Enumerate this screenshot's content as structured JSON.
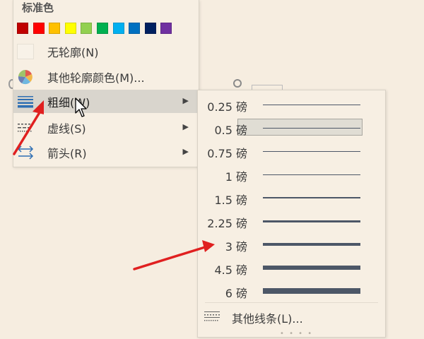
{
  "menu": {
    "standard_colors_title": "标准色",
    "swatches": [
      "#c00000",
      "#ff0000",
      "#ffc000",
      "#ffff00",
      "#92d050",
      "#00b050",
      "#00b0f0",
      "#0070c0",
      "#002060",
      "#7030a0"
    ],
    "items": [
      {
        "label": "无轮廓(N)",
        "icon": "no-outline-box",
        "has_submenu": false
      },
      {
        "label": "其他轮廓颜色(M)...",
        "icon": "color-palette-icon",
        "has_submenu": false
      },
      {
        "label": "粗细(W)",
        "icon": "line-weight-icon",
        "has_submenu": true,
        "highlighted": true
      },
      {
        "label": "虚线(S)",
        "icon": "dash-line-icon",
        "has_submenu": true
      },
      {
        "label": "箭头(R)",
        "icon": "arrows-icon",
        "has_submenu": true
      }
    ]
  },
  "weight_submenu": {
    "items": [
      {
        "label": "0.25 磅",
        "weight": 0.25
      },
      {
        "label": "0.5 磅",
        "weight": 0.5,
        "selected": true
      },
      {
        "label": "0.75 磅",
        "weight": 0.75
      },
      {
        "label": "1 磅",
        "weight": 1
      },
      {
        "label": "1.5 磅",
        "weight": 1.5
      },
      {
        "label": "2.25 磅",
        "weight": 2.25
      },
      {
        "label": "3 磅",
        "weight": 3
      },
      {
        "label": "4.5 磅",
        "weight": 4.5
      },
      {
        "label": "6 磅",
        "weight": 6
      }
    ],
    "other_lines_label": "其他线条(L)...",
    "grip": "• • • •"
  },
  "colors": {
    "menu_bg": "#f7efe3",
    "highlight": "#d9d5cd",
    "line_color": "#4d5767",
    "annotation_arrow": "#e02020"
  }
}
